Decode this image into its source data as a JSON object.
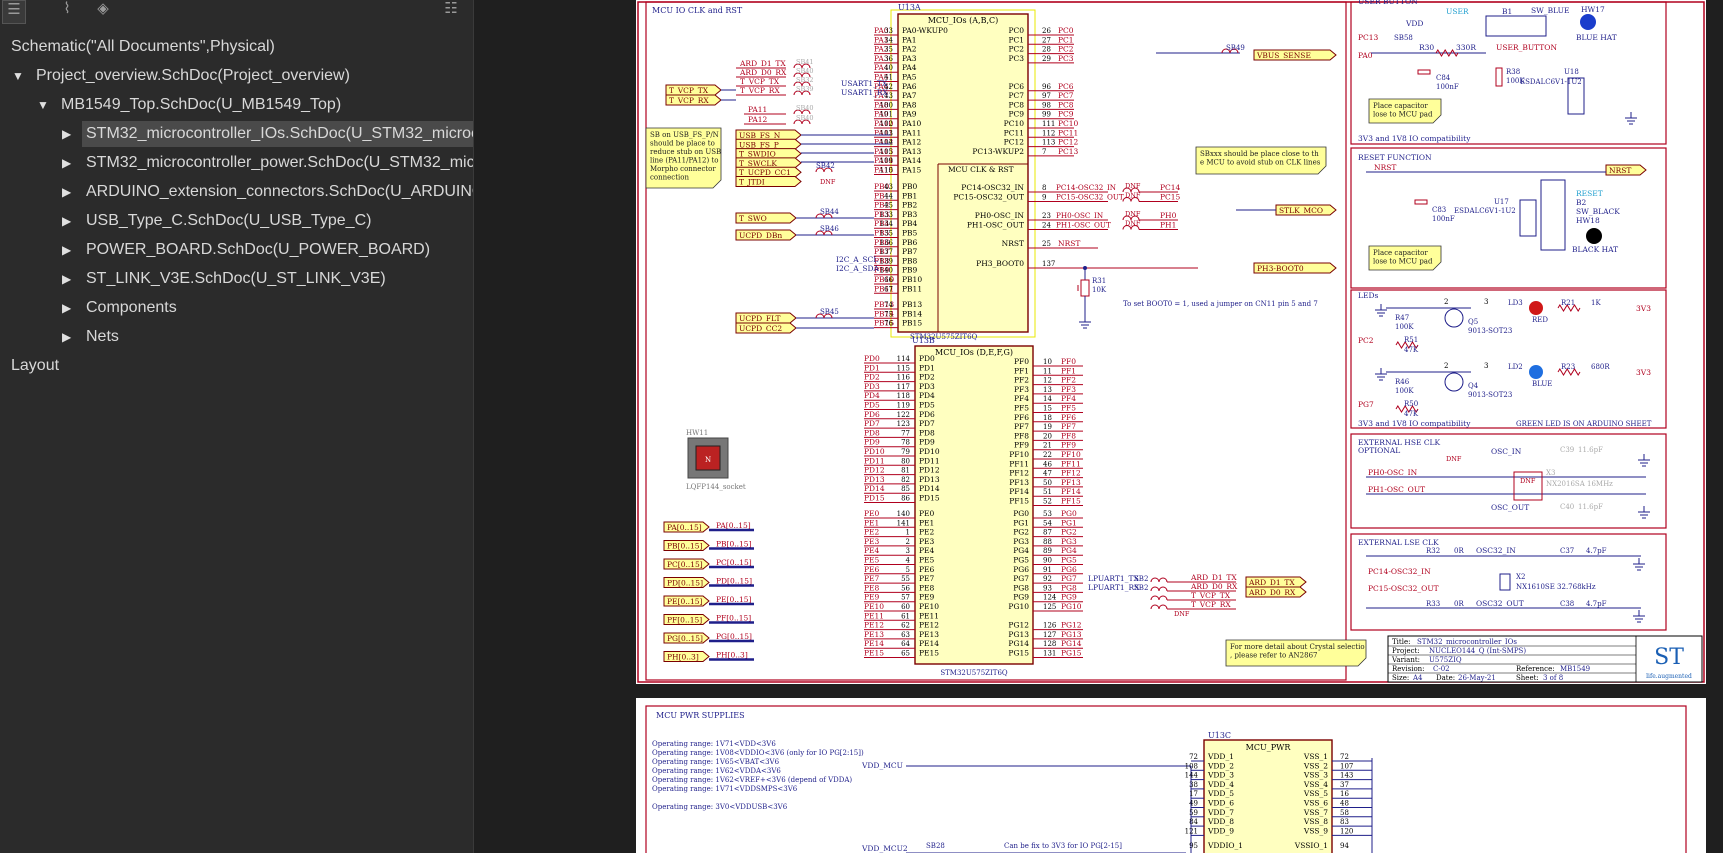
{
  "toolbar": {
    "icons": [
      "list-icon",
      "attachment-icon",
      "layers-icon",
      "hierarchy-icon"
    ]
  },
  "tree": [
    {
      "label": "Schematic(\"All Documents\",Physical)"
    },
    {
      "label": "Project_overview.SchDoc(Project_overview)",
      "arrow": "▼"
    },
    {
      "label": "MB1549_Top.SchDoc(U_MB1549_Top)",
      "arrow": "▼"
    },
    {
      "label": "STM32_microcontroller_IOs.SchDoc(U_STM32_microcontroller_IOs)",
      "arrow": "▶",
      "selected": true
    },
    {
      "label": "STM32_microcontroller_power.SchDoc(U_STM32_microcontroller_power)",
      "arrow": "▶"
    },
    {
      "label": "ARDUINO_extension_connectors.SchDoc(U_ARDUINO_extension_connectors)",
      "arrow": "▶"
    },
    {
      "label": "USB_Type_C.SchDoc(U_USB_Type_C)",
      "arrow": "▶"
    },
    {
      "label": "POWER_BOARD.SchDoc(U_POWER_BOARD)",
      "arrow": "▶"
    },
    {
      "label": "ST_LINK_V3E.SchDoc(U_ST_LINK_V3E)",
      "arrow": "▶"
    },
    {
      "label": "Components",
      "arrow": "▶"
    },
    {
      "label": "Nets",
      "arrow": "▶"
    },
    {
      "label": "Layout"
    }
  ],
  "sheet1": {
    "frame_title": "MCU IO CLK and RST",
    "u13a_ref": "U13A",
    "u13a_title": "MCU_IOs (A,B,C)",
    "u13b_ref": "U13B",
    "u13b_title": "MCU_IOs (D,E,F,G)",
    "part_number": "STM32U575ZIT6Q",
    "clk_section": "MCU CLK & RST",
    "pins_a": [
      [
        "PA0",
        "33",
        "PA0-WKUP0"
      ],
      [
        "PA1",
        "34",
        "PA1"
      ],
      [
        "PA2",
        "35",
        "PA2"
      ],
      [
        "PA3",
        "36",
        "PA3"
      ],
      [
        "PA4",
        "40",
        "PA4"
      ],
      [
        "PA5",
        "41",
        "PA5"
      ],
      [
        "PA6",
        "42",
        "PA6"
      ],
      [
        "PA7",
        "43",
        "PA7"
      ],
      [
        "PA8",
        "100",
        "PA8"
      ],
      [
        "PA9",
        "101",
        "PA9"
      ],
      [
        "PA10",
        "102",
        "PA10"
      ],
      [
        "PA11",
        "103",
        "PA11"
      ],
      [
        "PA12",
        "104",
        "PA12"
      ],
      [
        "PA13",
        "105",
        "PA13"
      ],
      [
        "PA14",
        "109",
        "PA14"
      ],
      [
        "PA15",
        "110",
        "PA15"
      ]
    ],
    "pins_b": [
      [
        "PB0",
        "43",
        "PB0"
      ],
      [
        "PB1",
        "44",
        "PB1"
      ],
      [
        "PB2",
        "45",
        "PB2"
      ],
      [
        "PB3",
        "133",
        "PB3"
      ],
      [
        "PB4",
        "134",
        "PB4"
      ],
      [
        "PB5",
        "135",
        "PB5"
      ],
      [
        "PB6",
        "136",
        "PB6"
      ],
      [
        "PB7",
        "137",
        "PB7"
      ],
      [
        "PB8",
        "139",
        "PB8"
      ],
      [
        "PB9",
        "140",
        "PB9"
      ],
      [
        "PB10",
        "66",
        "PB10"
      ],
      [
        "PB11",
        "67",
        "PB11"
      ]
    ],
    "pins_b2": [
      [
        "PB13",
        "74",
        "PB13"
      ],
      [
        "PB14",
        "75",
        "PB14"
      ],
      [
        "PB15",
        "76",
        "PB15"
      ]
    ],
    "pins_c": [
      [
        "PC0",
        "26",
        "PC0"
      ],
      [
        "PC1",
        "27",
        "PC1"
      ],
      [
        "PC2",
        "28",
        "PC2"
      ],
      [
        "PC3",
        "29",
        "PC3"
      ],
      [
        "",
        "",
        ""
      ],
      [
        "",
        "",
        ""
      ],
      [
        "PC6",
        "96",
        "PC6"
      ],
      [
        "PC7",
        "97",
        "PC7"
      ],
      [
        "PC8",
        "98",
        "PC8"
      ],
      [
        "PC9",
        "99",
        "PC9"
      ],
      [
        "PC10",
        "111",
        "PC10"
      ],
      [
        "PC11",
        "112",
        "PC11"
      ],
      [
        "PC12",
        "113",
        "PC12"
      ],
      [
        "PC13",
        "7",
        "PC13-WKUP2"
      ]
    ],
    "pins_clk": [
      [
        "PC14",
        "8",
        "PC14-OSC32_IN",
        "PC14-OSC32_IN"
      ],
      [
        "PC15",
        "9",
        "PC15-OSC32_OUT",
        "PC15-OSC32_OUT"
      ],
      [
        "PH0",
        "23",
        "PH0-OSC_IN",
        "PH0-OSC_IN"
      ],
      [
        "PH1",
        "24",
        "PH1-OSC_OUT",
        "PH1-OSC_OUT"
      ]
    ],
    "nrst": [
      "25",
      "NRST",
      "NRST"
    ],
    "boot": [
      "137",
      "PH3_BOOT0",
      "PH3-BOOT0"
    ],
    "pins_d": [
      [
        "PD0",
        "114"
      ],
      [
        "PD1",
        "115"
      ],
      [
        "PD2",
        "116"
      ],
      [
        "PD3",
        "117"
      ],
      [
        "PD4",
        "118"
      ],
      [
        "PD5",
        "119"
      ],
      [
        "PD6",
        "122"
      ],
      [
        "PD7",
        "123"
      ],
      [
        "PD8",
        "77"
      ],
      [
        "PD9",
        "78"
      ],
      [
        "PD10",
        "79"
      ],
      [
        "PD11",
        "80"
      ],
      [
        "PD12",
        "81"
      ],
      [
        "PD13",
        "82"
      ],
      [
        "PD14",
        "85"
      ],
      [
        "PD15",
        "86"
      ]
    ],
    "pins_e": [
      [
        "PE0",
        "140"
      ],
      [
        "PE1",
        "141"
      ],
      [
        "PE2",
        "1"
      ],
      [
        "PE3",
        "2"
      ],
      [
        "PE4",
        "3"
      ],
      [
        "PE5",
        "4"
      ],
      [
        "PE6",
        "5"
      ],
      [
        "PE7",
        "55"
      ],
      [
        "PE8",
        "56"
      ],
      [
        "PE9",
        "57"
      ],
      [
        "PE10",
        "60"
      ],
      [
        "PE11",
        "61"
      ],
      [
        "PE12",
        "62"
      ],
      [
        "PE13",
        "63"
      ],
      [
        "PE14",
        "64"
      ],
      [
        "PE15",
        "65"
      ]
    ],
    "pins_f": [
      [
        "PF0",
        "10"
      ],
      [
        "PF1",
        "11"
      ],
      [
        "PF2",
        "12"
      ],
      [
        "PF3",
        "13"
      ],
      [
        "PF4",
        "14"
      ],
      [
        "PF5",
        "15"
      ],
      [
        "PF6",
        "18"
      ],
      [
        "PF7",
        "19"
      ],
      [
        "PF8",
        "20"
      ],
      [
        "PF9",
        "21"
      ],
      [
        "PF10",
        "22"
      ],
      [
        "PF11",
        "46"
      ],
      [
        "PF12",
        "47"
      ],
      [
        "PF13",
        "50"
      ],
      [
        "PF14",
        "51"
      ],
      [
        "PF15",
        "52"
      ]
    ],
    "pins_g": [
      [
        "PG0",
        "53"
      ],
      [
        "PG1",
        "54"
      ],
      [
        "PG2",
        "87"
      ],
      [
        "PG3",
        "88"
      ],
      [
        "PG4",
        "89"
      ],
      [
        "PG5",
        "90"
      ],
      [
        "PG6",
        "91"
      ],
      [
        "PG7",
        "92"
      ],
      [
        "PG8",
        "93"
      ],
      [
        "PG9",
        "124"
      ],
      [
        "PG10",
        "125"
      ],
      [
        "",
        ""
      ],
      [
        "PG12",
        "126"
      ],
      [
        "PG13",
        "127"
      ],
      [
        "PG14",
        "128"
      ],
      [
        "PG15",
        "131"
      ]
    ],
    "left_ports": [
      "T_VCP_TX",
      "T_VCP_RX"
    ],
    "left_nets": [
      "ARD_D1_TX",
      "ARD_D0_RX",
      "T_VCP_TX",
      "T_VCP_RX"
    ],
    "usart_labels": [
      "USART1_TX",
      "USART1_RX"
    ],
    "sb_refs": [
      "SB41",
      "SB40",
      "SB32",
      "SB39",
      "SB42",
      "SB44",
      "SB46",
      "SB45",
      "SB6",
      "SB47",
      "SB49",
      "SB58",
      "SB29",
      "SB28"
    ],
    "mid_ports": [
      "USB_FS_N",
      "USB_FS_P",
      "T_SWDIO",
      "T_SWCLK",
      "T_UCPD_CC1",
      "T_JTDI"
    ],
    "pa11_12": [
      "PA11",
      "PA12"
    ],
    "swo_ports": [
      "T_SWO",
      "UCPD_DBn"
    ],
    "i2c": [
      "I2C_A_SCL",
      "I2C_A_SDA"
    ],
    "ucpd_ports": [
      "UCPD_FLT",
      "UCPD_CC2"
    ],
    "bus_ports": [
      "PA[0..15]",
      "PB[0..15]",
      "PC[0..15]",
      "PD[0..15]",
      "PE[0..15]",
      "PF[0..15]",
      "PG[0..15]",
      "PH[0..3]"
    ],
    "note_sb": "SB on USB_FS_P/N should be place to reduce stub on USB line (PA11/PA12) to Morpho connector connection",
    "note_sbxxx": "SBxxx should be place close to the MCU to avoid stub on CLK lines",
    "vbus_port": "VBUS_SENSE",
    "stlk_port": "STLK_MCO",
    "nrst_port": "NRST",
    "boot_port": "PH3-BOOT0",
    "r31": "R31",
    "r31_val": "10K",
    "boot_note": "To set BOOT0 = 1, used a jumper on CN11 pin 5 and 7",
    "hw_ref": "HW11",
    "hw_name": "LQFP144_socket",
    "lpuart": [
      "LPUART1_TX",
      "LPUART1_RX"
    ],
    "lpuart_nets": [
      "ARD_D1_TX",
      "ARD_D0_RX",
      "T_VCP_TX",
      "T_VCP_RX"
    ],
    "lpuart_ports": [
      "ARD_D1_TX",
      "ARD_D0_RX"
    ],
    "dnf": "DNF",
    "user_button": {
      "title": "USER BUTTON",
      "vdd": "VDD",
      "user": "USER",
      "b1": "B1",
      "sw": "SW_BLUE",
      "hw17": "HW17",
      "hat": "BLUE HAT",
      "pc13": "PC13",
      "pa0": "PA0",
      "r30": "R30",
      "r30_val": "330R",
      "net": "USER_BUTTON",
      "c84": "C84",
      "c84_val": "100nF",
      "r38": "R38",
      "r38_val": "100K",
      "u18": "U18",
      "esd": "ESDALC6V1-1U2",
      "note": "Place capacitor close to MCU pad",
      "compat": "3V3 and 1V8 IO compatibility"
    },
    "reset": {
      "title": "RESET FUNCTION",
      "nrst": "NRST",
      "port": "NRST",
      "c83": "C83",
      "c83_val": "100nF",
      "u17": "U17",
      "esd": "ESDALC6V1-1U2",
      "label": "RESET",
      "b2": "B2",
      "sw": "SW_BLACK",
      "hw": "HW18",
      "hat": "BLACK HAT",
      "note": "Place capacitor close to MCU pad"
    },
    "leds": {
      "title": "LEDs",
      "pc2": "PC2",
      "pg7": "PG7",
      "r47": "R47",
      "r47_val": "100K",
      "r51": "R51",
      "r51_val": "47K",
      "q5": "Q5",
      "q5_part": "9013-SOT23",
      "ld3": "LD3",
      "red": "RED",
      "r21": "R21",
      "r21_val": "1K",
      "v3": "3V3",
      "r46": "R46",
      "r46_val": "100K",
      "r50": "R50",
      "r50_val": "47K",
      "q4": "Q4",
      "q4_part": "9013-SOT23",
      "ld2": "LD2",
      "blue": "BLUE",
      "r23": "R23",
      "r23_val": "680R",
      "compat": "3V3 and 1V8 IO compatibility",
      "green": "GREEN LED IS ON ARDUINO SHEET"
    },
    "hse": {
      "title": "EXTERNAL HSE CLK",
      "opt": "OPTIONAL",
      "in": "PH0-OSC_IN",
      "out": "PH1-OSC_OUT",
      "osc_in": "OSC_IN",
      "osc_out": "OSC_OUT",
      "x": "X3",
      "part": "NX2016SA 16MHz",
      "c39": "C39",
      "c40": "C40",
      "cap": "11.6pF"
    },
    "lse": {
      "title": "EXTERNAL LSE CLK",
      "in": "PC14-OSC32_IN",
      "out": "PC15-OSC32_OUT",
      "osc_in": "OSC32_IN",
      "osc_out": "OSC32_OUT",
      "r32": "R32",
      "r33": "R33",
      "r_val": "0R",
      "c37": "C37",
      "c38": "C38",
      "cap": "4.7pF",
      "x": "X2",
      "part": "NX1610SE 32.768kHz"
    },
    "crystal_note": "For more detail about Crystal selection, please refer to AN2867",
    "title_block": {
      "title_k": "Title:",
      "title_v": "STM32_microcontroller_IOs",
      "project_k": "Project:",
      "project_v": "NUCLEO144_Q (Int-SMPS)",
      "variant_k": "Variant:",
      "variant_v": "U575ZIQ",
      "rev_k": "Revision:",
      "rev_v": "C-02",
      "ref_k": "Reference:",
      "ref_v": "MB1549",
      "size_k": "Size:",
      "size_v": "A4",
      "date_k": "Date:",
      "date_v": "26-May-21",
      "sheet_k": "Sheet:",
      "sheet_v": "3 of 8",
      "logo": "ST",
      "logo_sub": "life.augmented"
    }
  },
  "sheet2": {
    "title": "MCU PWR SUPPLIES",
    "ranges": [
      "Operating range: 1V71<VDD<3V6",
      "Operating range: 1V08<VDDIO<3V6 (only for IO PG[2:15])",
      "Operating range: 1V65<VBAT<3V6",
      "Operating range: 1V62<VDDA<3V6",
      "Operating range: 1V62<VREF+<3V6 (depend of VDDA)",
      "Operating range: 1V71<VDDSMPS<3V6",
      "",
      "Operating range: 3V0<VDDUSB<3V6"
    ],
    "vdd_mcu": "VDD_MCU",
    "vdd_mcu2": "VDD_MCU2",
    "sb28": "SB28",
    "fix_note": "Can be fix to 3V3 for IO PG[2-15]",
    "u13c": "U13C",
    "mcu_pwr": "MCU_PWR",
    "vdd_pins": [
      [
        "VDD_1",
        "72"
      ],
      [
        "VDD_2",
        "108"
      ],
      [
        "VDD_3",
        "144"
      ],
      [
        "VDD_4",
        "38"
      ],
      [
        "VDD_5",
        "17"
      ],
      [
        "VDD_6",
        "49"
      ],
      [
        "VDD_7",
        "59"
      ],
      [
        "VDD_8",
        "84"
      ],
      [
        "VDD_9",
        "121"
      ]
    ],
    "vss_pins": [
      [
        "VSS_1",
        "72"
      ],
      [
        "VSS_2",
        "107"
      ],
      [
        "VSS_3",
        "143"
      ],
      [
        "VSS_4",
        "37"
      ],
      [
        "VSS_5",
        "16"
      ],
      [
        "VSS_6",
        "48"
      ],
      [
        "VSS_7",
        "58"
      ],
      [
        "VSS_8",
        "83"
      ],
      [
        "VSS_9",
        "120"
      ]
    ],
    "vddio": [
      "VDDIO_1",
      "95"
    ],
    "vssio": [
      "VSSIO_1",
      "94"
    ]
  }
}
